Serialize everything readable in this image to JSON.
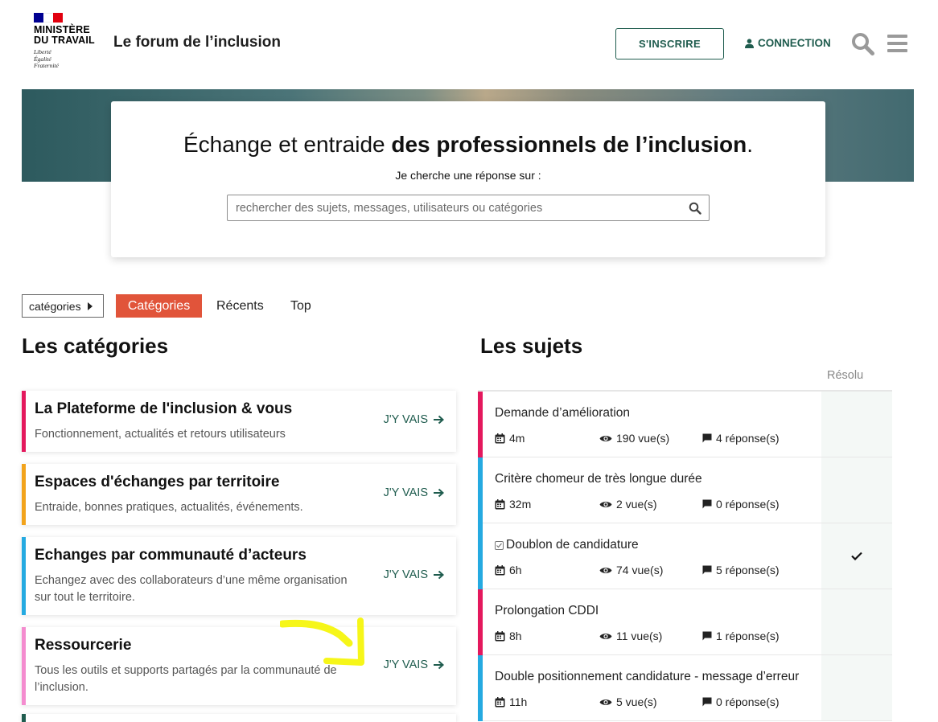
{
  "header": {
    "logo_line1": "MINISTÈRE",
    "logo_line2": "DU TRAVAIL",
    "motto1": "Liberté",
    "motto2": "Égalité",
    "motto3": "Fraternité",
    "site_title": "Le forum de l’inclusion",
    "signup_label": "S'INSCRIRE",
    "login_label": "CONNECTION",
    "icons": [
      "user-icon",
      "search-icon",
      "menu-icon"
    ]
  },
  "hero": {
    "title_normal": "Échange et entraide ",
    "title_bold": "des professionnels de l’inclusion",
    "title_end": ".",
    "subtitle": "Je cherche une réponse sur :",
    "search_placeholder": "rechercher des sujets, messages, utilisateurs ou catégories"
  },
  "nav": {
    "dropdown_label": "catégories",
    "tabs": [
      {
        "label": "Catégories",
        "active": true
      },
      {
        "label": "Récents",
        "active": false
      },
      {
        "label": "Top",
        "active": false
      }
    ]
  },
  "categories": {
    "heading": "Les catégories",
    "go_label": "J'Y VAIS",
    "items": [
      {
        "title": "La Plateforme de l'inclusion & vous",
        "description": "Fonctionnement, actualités et retours utilisateurs",
        "color": "#e4185d"
      },
      {
        "title": "Espaces d'échanges par territoire",
        "description": "Entraide, bonnes pratiques, actualités, événements.",
        "color": "#f2a31b"
      },
      {
        "title": "Echanges par communauté d’acteurs",
        "description": "Echangez avec des collaborateurs d’une même organisation sur tout le territoire.",
        "color": "#25aae1"
      },
      {
        "title": "Ressourcerie",
        "description": "Tous les outils et supports partagés par la communauté de l’inclusion.",
        "color": "#f48ccf"
      }
    ]
  },
  "topics": {
    "heading": "Les sujets",
    "resolved_header": "Résolu",
    "items": [
      {
        "title": "Demande d’amélioration",
        "time": "4m",
        "views": "190 vue(s)",
        "replies": "4 réponse(s)",
        "color": "#e4185d",
        "resolved": false,
        "solved_icon": false
      },
      {
        "title": "Critère chomeur de très longue durée",
        "time": "32m",
        "views": "2 vue(s)",
        "replies": "0 réponse(s)",
        "color": "#25aae1",
        "resolved": false,
        "solved_icon": false
      },
      {
        "title": "Doublon de candidature",
        "time": "6h",
        "views": "74 vue(s)",
        "replies": "5 réponse(s)",
        "color": "#25aae1",
        "resolved": true,
        "solved_icon": true
      },
      {
        "title": "Prolongation CDDI",
        "time": "8h",
        "views": "11 vue(s)",
        "replies": "1 réponse(s)",
        "color": "#e4185d",
        "resolved": false,
        "solved_icon": false
      },
      {
        "title": "Double positionnement candidature - message d’erreur",
        "time": "11h",
        "views": "5 vue(s)",
        "replies": "0 réponse(s)",
        "color": "#25aae1",
        "resolved": false,
        "solved_icon": false
      }
    ]
  },
  "colors": {
    "accent_green": "#1f5c4e",
    "active_tab": "#e1543a",
    "highlight": "#f5f500"
  }
}
